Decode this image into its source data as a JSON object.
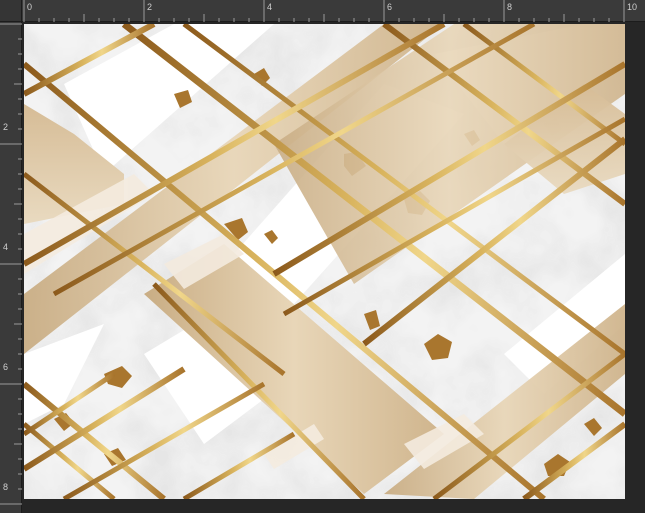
{
  "ruler": {
    "unit": "in",
    "top_labels": [
      "0",
      "2",
      "4",
      "6",
      "8",
      "10"
    ],
    "left_labels": [
      "2",
      "4",
      "6",
      "8"
    ]
  },
  "document": {
    "artwork": "gold-and-marble-diagonal-pattern",
    "colors": {
      "marble": "#f2f2f2",
      "marble_vein": "#c9c9c9",
      "gold": "#c9a04a",
      "gold_dark": "#9a6a24",
      "beige": "#dcc4a0",
      "cream": "#f3e9dc"
    }
  }
}
